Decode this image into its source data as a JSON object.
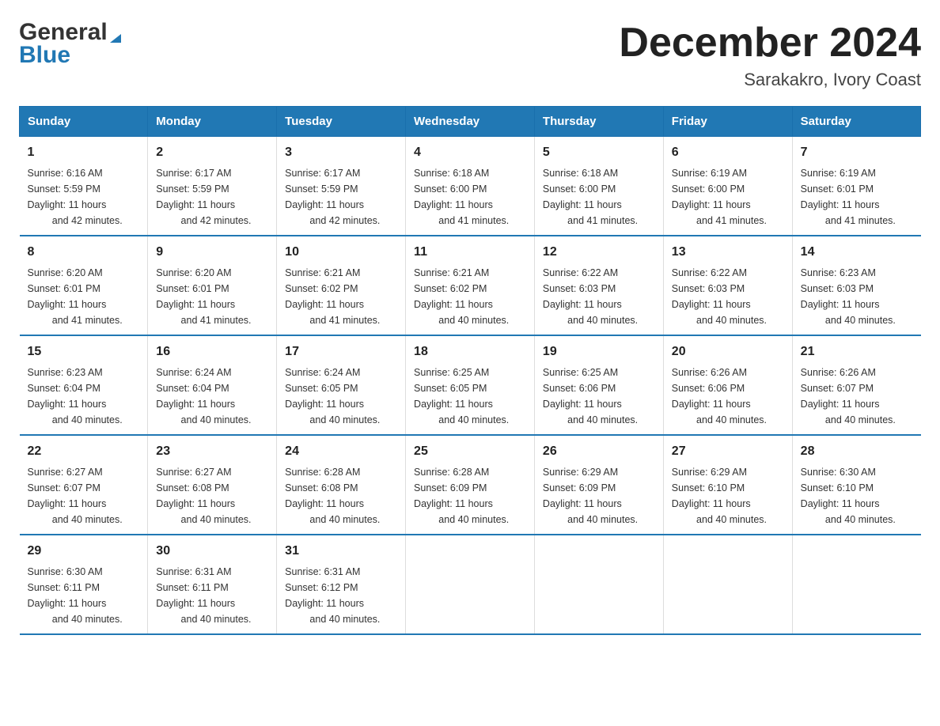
{
  "header": {
    "logo_general": "General",
    "logo_blue": "Blue",
    "title": "December 2024",
    "subtitle": "Sarakakro, Ivory Coast"
  },
  "days_of_week": [
    "Sunday",
    "Monday",
    "Tuesday",
    "Wednesday",
    "Thursday",
    "Friday",
    "Saturday"
  ],
  "weeks": [
    [
      {
        "day": "1",
        "sunrise": "6:16 AM",
        "sunset": "5:59 PM",
        "daylight": "11 hours and 42 minutes."
      },
      {
        "day": "2",
        "sunrise": "6:17 AM",
        "sunset": "5:59 PM",
        "daylight": "11 hours and 42 minutes."
      },
      {
        "day": "3",
        "sunrise": "6:17 AM",
        "sunset": "5:59 PM",
        "daylight": "11 hours and 42 minutes."
      },
      {
        "day": "4",
        "sunrise": "6:18 AM",
        "sunset": "6:00 PM",
        "daylight": "11 hours and 41 minutes."
      },
      {
        "day": "5",
        "sunrise": "6:18 AM",
        "sunset": "6:00 PM",
        "daylight": "11 hours and 41 minutes."
      },
      {
        "day": "6",
        "sunrise": "6:19 AM",
        "sunset": "6:00 PM",
        "daylight": "11 hours and 41 minutes."
      },
      {
        "day": "7",
        "sunrise": "6:19 AM",
        "sunset": "6:01 PM",
        "daylight": "11 hours and 41 minutes."
      }
    ],
    [
      {
        "day": "8",
        "sunrise": "6:20 AM",
        "sunset": "6:01 PM",
        "daylight": "11 hours and 41 minutes."
      },
      {
        "day": "9",
        "sunrise": "6:20 AM",
        "sunset": "6:01 PM",
        "daylight": "11 hours and 41 minutes."
      },
      {
        "day": "10",
        "sunrise": "6:21 AM",
        "sunset": "6:02 PM",
        "daylight": "11 hours and 41 minutes."
      },
      {
        "day": "11",
        "sunrise": "6:21 AM",
        "sunset": "6:02 PM",
        "daylight": "11 hours and 40 minutes."
      },
      {
        "day": "12",
        "sunrise": "6:22 AM",
        "sunset": "6:03 PM",
        "daylight": "11 hours and 40 minutes."
      },
      {
        "day": "13",
        "sunrise": "6:22 AM",
        "sunset": "6:03 PM",
        "daylight": "11 hours and 40 minutes."
      },
      {
        "day": "14",
        "sunrise": "6:23 AM",
        "sunset": "6:03 PM",
        "daylight": "11 hours and 40 minutes."
      }
    ],
    [
      {
        "day": "15",
        "sunrise": "6:23 AM",
        "sunset": "6:04 PM",
        "daylight": "11 hours and 40 minutes."
      },
      {
        "day": "16",
        "sunrise": "6:24 AM",
        "sunset": "6:04 PM",
        "daylight": "11 hours and 40 minutes."
      },
      {
        "day": "17",
        "sunrise": "6:24 AM",
        "sunset": "6:05 PM",
        "daylight": "11 hours and 40 minutes."
      },
      {
        "day": "18",
        "sunrise": "6:25 AM",
        "sunset": "6:05 PM",
        "daylight": "11 hours and 40 minutes."
      },
      {
        "day": "19",
        "sunrise": "6:25 AM",
        "sunset": "6:06 PM",
        "daylight": "11 hours and 40 minutes."
      },
      {
        "day": "20",
        "sunrise": "6:26 AM",
        "sunset": "6:06 PM",
        "daylight": "11 hours and 40 minutes."
      },
      {
        "day": "21",
        "sunrise": "6:26 AM",
        "sunset": "6:07 PM",
        "daylight": "11 hours and 40 minutes."
      }
    ],
    [
      {
        "day": "22",
        "sunrise": "6:27 AM",
        "sunset": "6:07 PM",
        "daylight": "11 hours and 40 minutes."
      },
      {
        "day": "23",
        "sunrise": "6:27 AM",
        "sunset": "6:08 PM",
        "daylight": "11 hours and 40 minutes."
      },
      {
        "day": "24",
        "sunrise": "6:28 AM",
        "sunset": "6:08 PM",
        "daylight": "11 hours and 40 minutes."
      },
      {
        "day": "25",
        "sunrise": "6:28 AM",
        "sunset": "6:09 PM",
        "daylight": "11 hours and 40 minutes."
      },
      {
        "day": "26",
        "sunrise": "6:29 AM",
        "sunset": "6:09 PM",
        "daylight": "11 hours and 40 minutes."
      },
      {
        "day": "27",
        "sunrise": "6:29 AM",
        "sunset": "6:10 PM",
        "daylight": "11 hours and 40 minutes."
      },
      {
        "day": "28",
        "sunrise": "6:30 AM",
        "sunset": "6:10 PM",
        "daylight": "11 hours and 40 minutes."
      }
    ],
    [
      {
        "day": "29",
        "sunrise": "6:30 AM",
        "sunset": "6:11 PM",
        "daylight": "11 hours and 40 minutes."
      },
      {
        "day": "30",
        "sunrise": "6:31 AM",
        "sunset": "6:11 PM",
        "daylight": "11 hours and 40 minutes."
      },
      {
        "day": "31",
        "sunrise": "6:31 AM",
        "sunset": "6:12 PM",
        "daylight": "11 hours and 40 minutes."
      },
      {
        "day": "",
        "sunrise": "",
        "sunset": "",
        "daylight": ""
      },
      {
        "day": "",
        "sunrise": "",
        "sunset": "",
        "daylight": ""
      },
      {
        "day": "",
        "sunrise": "",
        "sunset": "",
        "daylight": ""
      },
      {
        "day": "",
        "sunrise": "",
        "sunset": "",
        "daylight": ""
      }
    ]
  ],
  "labels": {
    "sunrise": "Sunrise:",
    "sunset": "Sunset:",
    "daylight": "Daylight:"
  }
}
